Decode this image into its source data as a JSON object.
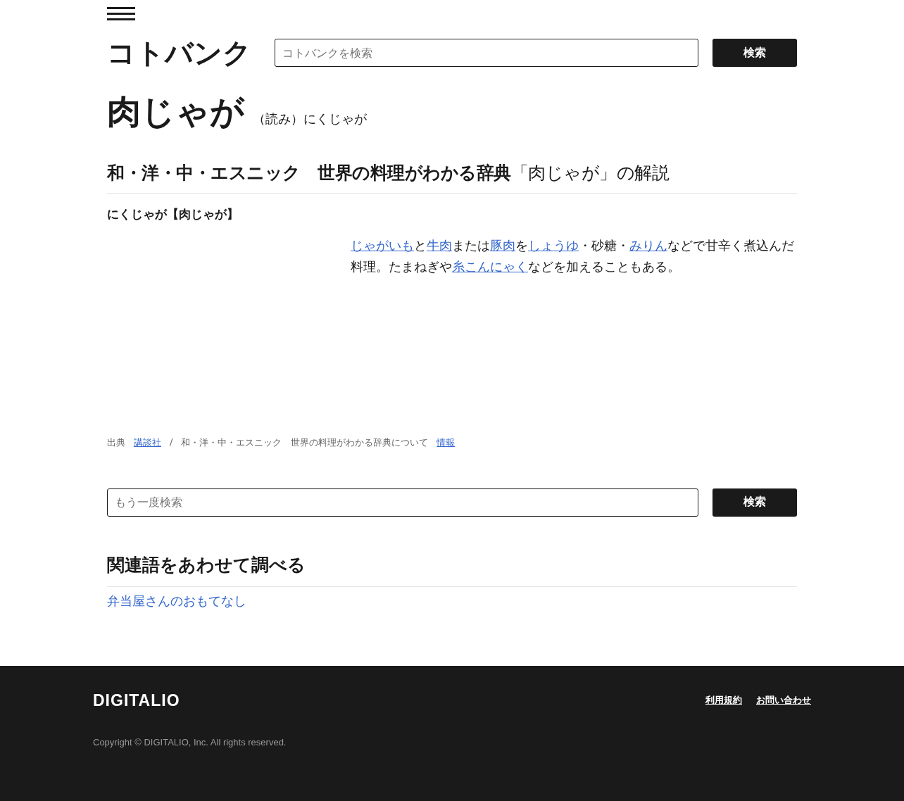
{
  "header": {
    "logo": "コトバンク",
    "search": {
      "placeholder": "コトバンクを検索"
    },
    "search_button": "検索"
  },
  "entry": {
    "title": "肉じゃが",
    "reading": "（読み）にくじゃが"
  },
  "section": {
    "heading": "**和・洋・中・エスニック　世界の料理がわかる辞典**「肉じゃが」の解説",
    "term": "にくじゃが【肉じゃが】",
    "definition": [
      {
        "text": "じゃがいも",
        "link": true
      },
      {
        "text": "と",
        "link": false
      },
      {
        "text": "牛肉",
        "link": true
      },
      {
        "text": "または",
        "link": false
      },
      {
        "text": "豚肉",
        "link": true
      },
      {
        "text": "を",
        "link": false
      },
      {
        "text": "しょうゆ",
        "link": true
      },
      {
        "text": "・砂糖・",
        "link": false
      },
      {
        "text": "みりん",
        "link": true
      },
      {
        "text": "などで甘辛く煮込んだ料理。たまねぎや",
        "link": false
      },
      {
        "text": "糸こんにゃく",
        "link": true
      },
      {
        "text": "などを加えることもある。",
        "link": false
      }
    ],
    "source": [
      {
        "text": "出典",
        "link": false
      },
      {
        "text": "講談社",
        "link": true
      },
      {
        "text": "/",
        "link": false
      },
      {
        "text": "和・洋・中・エスニック　世界の料理がわかる辞典について",
        "link": false
      },
      {
        "text": "情報",
        "link": true
      }
    ]
  },
  "search_again": {
    "placeholder": "もう一度検索",
    "button": "検索"
  },
  "related": {
    "heading": "関連語をあわせて調べる",
    "items": [
      "弁当屋さんのおもてなし"
    ]
  },
  "footer": {
    "logo": "DIGITALIO",
    "links": [
      "利用規約",
      "お問い合わせ"
    ],
    "copyright": "Copyright © DIGITALIO, Inc. All rights reserved."
  }
}
